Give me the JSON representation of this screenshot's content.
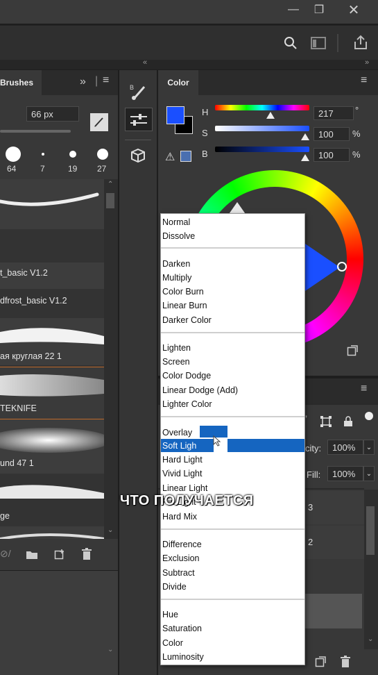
{
  "window": {
    "minimize_icon": "minimize-icon",
    "restore_icon": "restore-icon",
    "close_icon": "close-icon"
  },
  "brushes": {
    "tab_label": "Brushes",
    "size_value": "66 px",
    "preset_sizes": [
      "64",
      "7",
      "19",
      "27"
    ],
    "items": [
      "t_basic V1.2",
      "dfrost_basic V1.2",
      "ая круглая 22 1",
      "TEKNIFE",
      "und 47 1",
      "ge"
    ]
  },
  "color": {
    "tab_label": "Color",
    "h_label": "H",
    "s_label": "S",
    "b_label": "B",
    "h_value": "217",
    "s_value": "100",
    "b_value": "100",
    "h_unit": "°",
    "s_unit": "%",
    "b_unit": "%",
    "foreground": "#1a4fff",
    "background": "#000000"
  },
  "layers": {
    "opacity_label": "city:",
    "opacity_value": "100%",
    "fill_label": "Fill:",
    "fill_value": "100%",
    "row_numbers": [
      "3",
      "2"
    ]
  },
  "blend_menu": {
    "groups": [
      [
        "Normal",
        "Dissolve"
      ],
      [
        "Darken",
        "Multiply",
        "Color Burn",
        "Linear Burn",
        "Darker Color"
      ],
      [
        "Lighten",
        "Screen",
        "Color Dodge",
        "Linear Dodge (Add)",
        "Lighter Color"
      ],
      [
        "Overlay",
        "Soft Light",
        "Hard Light",
        "Vivid Light",
        "Linear Light",
        "Pin Light",
        "Hard Mix"
      ],
      [
        "Difference",
        "Exclusion",
        "Subtract",
        "Divide"
      ],
      [
        "Hue",
        "Saturation",
        "Color",
        "Luminosity"
      ]
    ],
    "selected": "Soft Light",
    "selected_visible": "Soft Ligh"
  },
  "caption": "ЧТО ПОЛУЧАЕТСЯ",
  "accent": "#1565c0"
}
